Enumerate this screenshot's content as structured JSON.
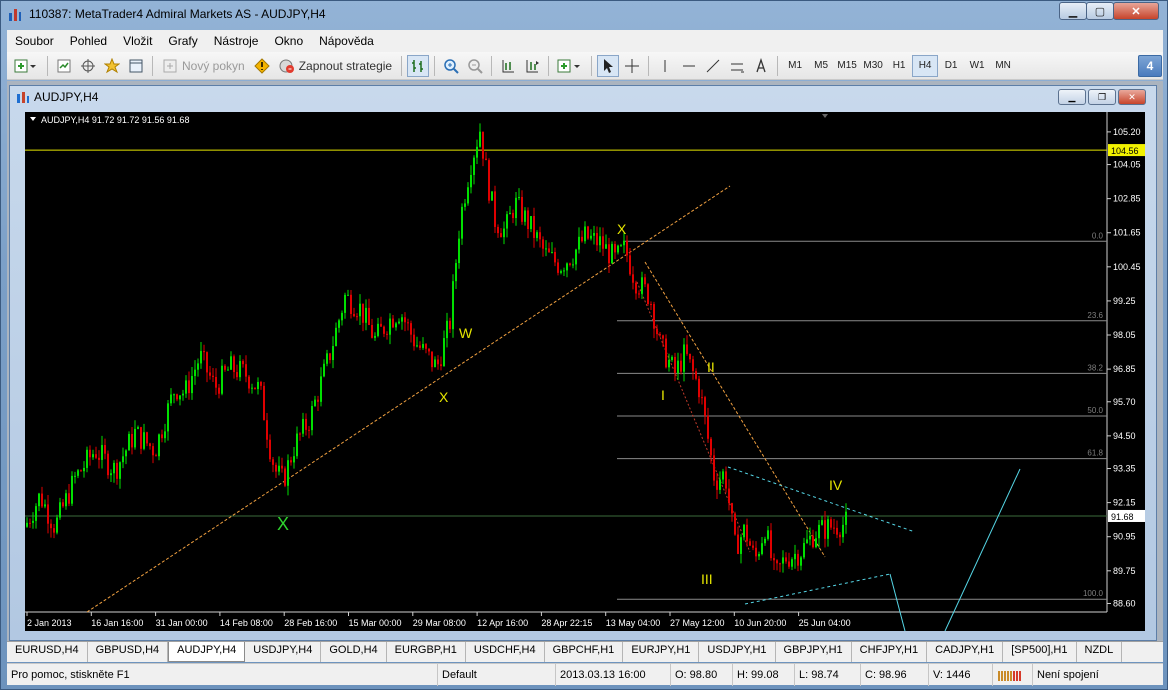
{
  "window": {
    "title": "110387: MetaTrader4 Admiral Markets AS - AUDJPY,H4"
  },
  "menu": [
    "Soubor",
    "Pohled",
    "Vložit",
    "Grafy",
    "Nástroje",
    "Okno",
    "Nápověda"
  ],
  "toolbar": {
    "new_order_label": "Nový pokyn",
    "autotrade_label": "Zapnout strategie",
    "timeframes": [
      "M1",
      "M5",
      "M15",
      "M30",
      "H1",
      "H4",
      "D1",
      "W1",
      "MN"
    ],
    "active_timeframe": "H4",
    "help_badge": "4"
  },
  "chart_window": {
    "title": "AUDJPY,H4"
  },
  "chart_data": {
    "type": "candlestick",
    "symbol": "AUDJPY,H4",
    "header": "AUDJPY,H4  91.72 91.72 91.56 91.68",
    "y_ticks": [
      "105.20",
      "104.05",
      "102.85",
      "101.65",
      "100.45",
      "99.25",
      "98.05",
      "96.85",
      "95.70",
      "94.50",
      "93.35",
      "92.15",
      "90.95",
      "89.75",
      "88.60"
    ],
    "x_ticks": [
      "2 Jan 2013",
      "16 Jan 16:00",
      "31 Jan 00:00",
      "14 Feb 08:00",
      "28 Feb 16:00",
      "15 Mar 00:00",
      "29 Mar 08:00",
      "12 Apr 16:00",
      "28 Apr 22:15",
      "13 May 04:00",
      "27 May 12:00",
      "10 Jun 20:00",
      "25 Jun 04:00"
    ],
    "ylim": [
      88.3,
      105.9
    ],
    "current_price": "91.68",
    "horizontal_line_price": "104.56",
    "fibonacci_levels": [
      "0.0",
      "23.6",
      "38.2",
      "50.0",
      "61.8",
      "100.0"
    ],
    "fibonacci_prices": [
      101.35,
      98.55,
      96.7,
      95.2,
      93.7,
      88.75
    ],
    "wave_labels": [
      "W",
      "X",
      "X",
      "X",
      "I",
      "II",
      "III",
      "IV"
    ],
    "price_path": [
      [
        0,
        91.3
      ],
      [
        15,
        92.4
      ],
      [
        30,
        91.3
      ],
      [
        50,
        93.0
      ],
      [
        70,
        94.0
      ],
      [
        90,
        93.3
      ],
      [
        110,
        94.6
      ],
      [
        130,
        94.0
      ],
      [
        150,
        96.2
      ],
      [
        160,
        96.0
      ],
      [
        175,
        97.3
      ],
      [
        190,
        96.2
      ],
      [
        205,
        96.9
      ],
      [
        220,
        96.7
      ],
      [
        235,
        96.1
      ],
      [
        245,
        94.1
      ],
      [
        250,
        93.3
      ],
      [
        258,
        92.9
      ],
      [
        270,
        94.2
      ],
      [
        285,
        95.1
      ],
      [
        305,
        97.4
      ],
      [
        320,
        99.4
      ],
      [
        335,
        99.0
      ],
      [
        350,
        97.9
      ],
      [
        365,
        98.6
      ],
      [
        375,
        98.9
      ],
      [
        390,
        97.8
      ],
      [
        405,
        97.2
      ],
      [
        412,
        96.9
      ],
      [
        425,
        98.5
      ],
      [
        435,
        102.1
      ],
      [
        445,
        104.0
      ],
      [
        455,
        105.3
      ],
      [
        463,
        103.4
      ],
      [
        470,
        102.1
      ],
      [
        480,
        101.7
      ],
      [
        490,
        102.7
      ],
      [
        505,
        101.9
      ],
      [
        520,
        100.9
      ],
      [
        535,
        100.5
      ],
      [
        548,
        100.9
      ],
      [
        560,
        101.5
      ],
      [
        575,
        101.3
      ],
      [
        590,
        100.7
      ],
      [
        600,
        101.1
      ],
      [
        610,
        100.0
      ],
      [
        625,
        99.4
      ],
      [
        635,
        97.7
      ],
      [
        650,
        96.7
      ],
      [
        660,
        97.4
      ],
      [
        675,
        96.1
      ],
      [
        690,
        92.9
      ],
      [
        700,
        93.2
      ],
      [
        710,
        90.6
      ],
      [
        720,
        91.2
      ],
      [
        730,
        90.1
      ],
      [
        740,
        91.3
      ],
      [
        750,
        89.5
      ],
      [
        760,
        90.2
      ],
      [
        775,
        90.4
      ],
      [
        790,
        91.1
      ],
      [
        805,
        91.3
      ],
      [
        820,
        91.4
      ],
      [
        830,
        91.8
      ]
    ]
  },
  "tabs": [
    "EURUSD,H4",
    "GBPUSD,H4",
    "AUDJPY,H4",
    "USDJPY,H4",
    "GOLD,H4",
    "EURGBP,H1",
    "USDCHF,H4",
    "GBPCHF,H1",
    "EURJPY,H1",
    "USDJPY,H1",
    "GBPJPY,H1",
    "CHFJPY,H1",
    "CADJPY,H1",
    "[SP500],H1",
    "NZDL"
  ],
  "active_tab": "AUDJPY,H4",
  "status": {
    "help": "Pro pomoc, stiskněte F1",
    "profile": "Default",
    "datetime": "2013.03.13 16:00",
    "open": "O: 98.80",
    "high": "H: 99.08",
    "low": "L: 98.74",
    "close": "C: 98.96",
    "volume": "V: 1446",
    "connection": "Není spojení"
  },
  "colors": {
    "chart_bg": "#000000",
    "bull": "#00e000",
    "bear": "#e00000",
    "yellow_line": "#e6e600",
    "trend": "#f0a040",
    "cyan": "#55d6e6"
  }
}
